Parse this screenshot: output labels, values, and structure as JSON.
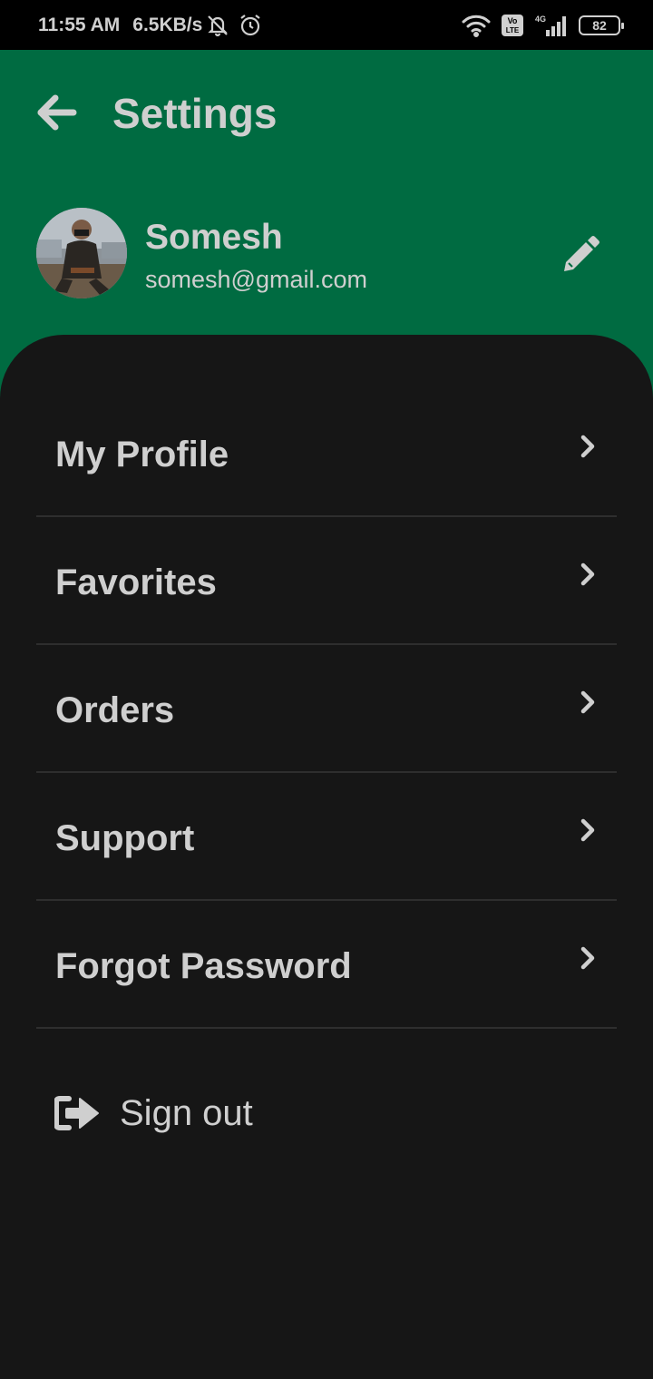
{
  "status_bar": {
    "time": "11:55 AM",
    "speed": "6.5KB/s",
    "battery": "82",
    "icons": [
      "notifications-off-icon",
      "alarm-icon",
      "wifi-icon",
      "volte-icon",
      "signal-4g-icon",
      "battery-icon"
    ],
    "volte_text": "Vo LTE",
    "network_text": "4G"
  },
  "header": {
    "title": "Settings",
    "back_icon": "arrow-left-icon",
    "background_color": "#006b41"
  },
  "profile": {
    "name": "Somesh",
    "email": "somesh@gmail.com",
    "edit_icon": "pencil-icon"
  },
  "menu": {
    "items": [
      {
        "label": "My Profile"
      },
      {
        "label": "Favorites"
      },
      {
        "label": "Orders"
      },
      {
        "label": "Support"
      },
      {
        "label": "Forgot Password"
      }
    ],
    "chevron_icon": "chevron-right-icon"
  },
  "signout": {
    "label": "Sign out",
    "icon": "sign-out-icon"
  }
}
